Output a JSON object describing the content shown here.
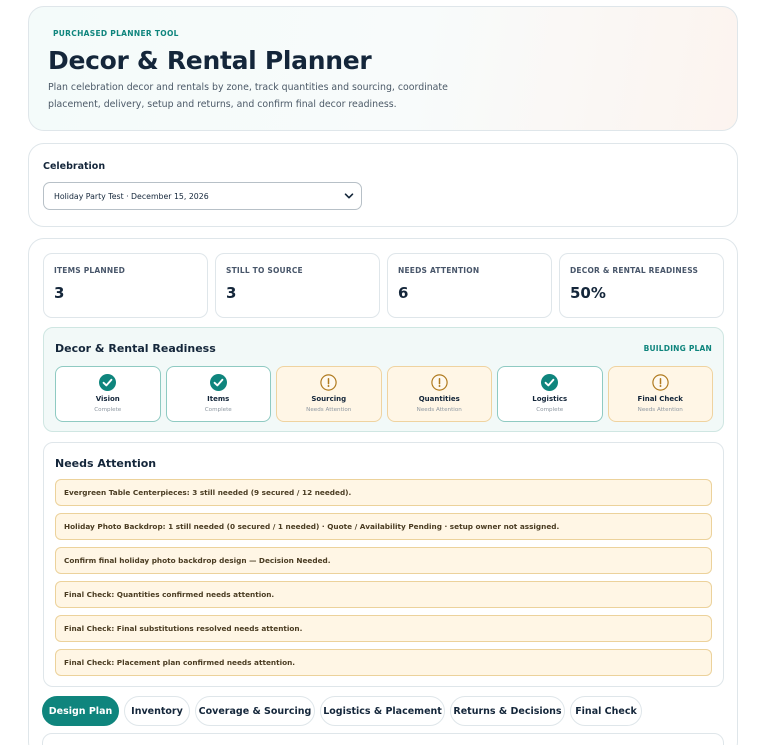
{
  "hero": {
    "eyebrow": "PURCHASED PLANNER TOOL",
    "title": "Decor & Rental Planner",
    "description": "Plan celebration decor and rentals by zone, track quantities and sourcing, coordinate placement, delivery, setup and returns, and confirm final decor readiness."
  },
  "celebration": {
    "label": "Celebration",
    "selected": "Holiday Party Test · December 15, 2026"
  },
  "stats": [
    {
      "label": "ITEMS PLANNED",
      "value": "3"
    },
    {
      "label": "STILL TO SOURCE",
      "value": "3"
    },
    {
      "label": "NEEDS ATTENTION",
      "value": "6"
    },
    {
      "label": "DECOR & RENTAL READINESS",
      "value": "50%"
    }
  ],
  "readiness": {
    "title": "Decor & Rental Readiness",
    "badge": "BUILDING PLAN",
    "steps": [
      {
        "name": "Vision",
        "status": "Complete",
        "state": "complete"
      },
      {
        "name": "Items",
        "status": "Complete",
        "state": "complete"
      },
      {
        "name": "Sourcing",
        "status": "Needs Attention",
        "state": "attention"
      },
      {
        "name": "Quantities",
        "status": "Needs Attention",
        "state": "attention"
      },
      {
        "name": "Logistics",
        "status": "Complete",
        "state": "complete"
      },
      {
        "name": "Final Check",
        "status": "Needs Attention",
        "state": "attention"
      }
    ]
  },
  "needs_attention": {
    "title": "Needs Attention",
    "items": [
      "Evergreen Table Centerpieces: 3 still needed (9 secured / 12 needed).",
      "Holiday Photo Backdrop: 1 still needed (0 secured / 1 needed) · Quote / Availability Pending · setup owner not assigned.",
      "Confirm final holiday photo backdrop design — Decision Needed.",
      "Final Check: Quantities confirmed needs attention.",
      "Final Check: Final substitutions resolved needs attention.",
      "Final Check: Placement plan confirmed needs attention."
    ]
  },
  "tabs": [
    {
      "label": "Design Plan",
      "active": true
    },
    {
      "label": "Inventory",
      "active": false
    },
    {
      "label": "Coverage & Sourcing",
      "active": false
    },
    {
      "label": "Logistics & Placement",
      "active": false
    },
    {
      "label": "Returns & Decisions",
      "active": false
    },
    {
      "label": "Final Check",
      "active": false
    }
  ],
  "colors": {
    "accent": "#0f857d",
    "complete_border": "#8fcac2",
    "attention_bg": "#fff6e6",
    "attention_icon": "#b07a1e"
  },
  "icons": {
    "complete": "check-circle-icon",
    "attention": "alert-circle-icon",
    "select": "chevron-down-icon"
  }
}
